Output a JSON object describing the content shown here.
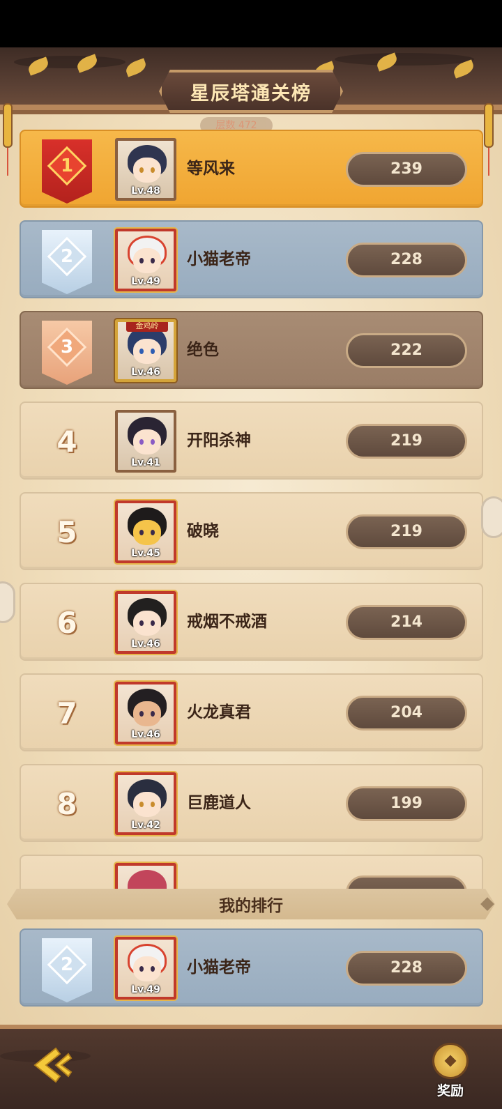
{
  "header": {
    "title": "星辰塔通关榜",
    "subtitle": "层数 472"
  },
  "colors": {
    "first_row": "#f0a531",
    "second_row": "#98acbf",
    "third_row": "#9a7d66",
    "default_row": "#e9d2ad",
    "score_pill": "#5f4a3d"
  },
  "rankings": [
    {
      "rank": "1",
      "name": "等风来",
      "level": "Lv.48",
      "score": "239"
    },
    {
      "rank": "2",
      "name": "小猫老帝",
      "level": "Lv.49",
      "score": "228"
    },
    {
      "rank": "3",
      "name": "绝色",
      "level": "Lv.46",
      "score": "222",
      "tag": "金鸡岭"
    },
    {
      "rank": "4",
      "name": "开阳杀神",
      "level": "Lv.41",
      "score": "219"
    },
    {
      "rank": "5",
      "name": "破晓",
      "level": "Lv.45",
      "score": "219"
    },
    {
      "rank": "6",
      "name": "戒烟不戒酒",
      "level": "Lv.46",
      "score": "214"
    },
    {
      "rank": "7",
      "name": "火龙真君",
      "level": "Lv.46",
      "score": "204"
    },
    {
      "rank": "8",
      "name": "巨鹿道人",
      "level": "Lv.42",
      "score": "199"
    }
  ],
  "my_rank": {
    "title": "我的排行",
    "rank": "2",
    "name": "小猫老帝",
    "level": "Lv.49",
    "score": "228"
  },
  "footer": {
    "back_icon": "back-arrow-icon",
    "reward_icon": "coin-icon",
    "reward_label": "奖励"
  }
}
